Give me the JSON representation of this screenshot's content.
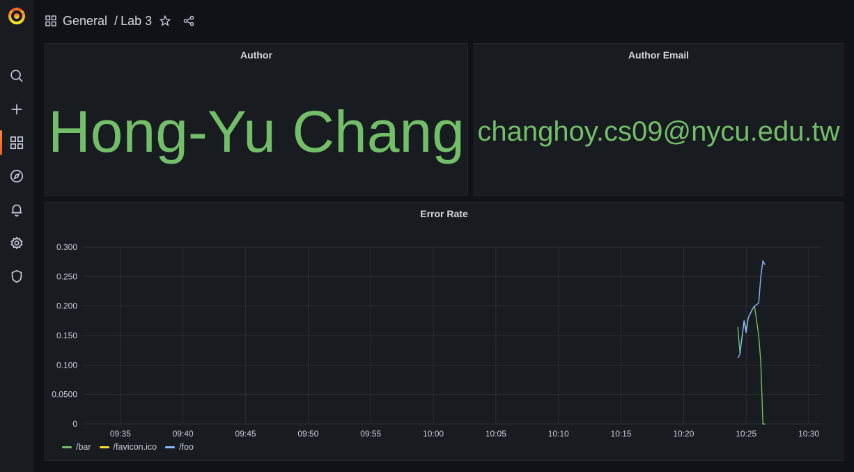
{
  "breadcrumb": {
    "folder": "General",
    "separator": "/",
    "dashboard": "Lab 3"
  },
  "panels": {
    "author": {
      "title": "Author",
      "value": "Hong-Yu Chang"
    },
    "email": {
      "title": "Author Email",
      "value": "changhoy.cs09@nycu.edu.tw"
    },
    "error_rate": {
      "title": "Error Rate"
    }
  },
  "colors": {
    "accent": "#f05a28",
    "stat_green": "#73bf69",
    "series_bar": "#73bf69",
    "series_favicon": "#fade2a",
    "series_foo": "#8ab8ff"
  },
  "chart_data": {
    "type": "line",
    "title": "Error Rate",
    "xlabel": "",
    "ylabel": "",
    "x_ticks": [
      "09:35",
      "09:40",
      "09:45",
      "09:50",
      "09:55",
      "10:00",
      "10:05",
      "10:10",
      "10:15",
      "10:20",
      "10:25",
      "10:30"
    ],
    "y_ticks": [
      "0",
      "0.0500",
      "0.100",
      "0.150",
      "0.200",
      "0.250",
      "0.300"
    ],
    "xlim": [
      "09:32",
      "10:31"
    ],
    "ylim": [
      0,
      0.3
    ],
    "grid": true,
    "legend_position": "bottom-left",
    "series": [
      {
        "name": "/bar",
        "color": "#73bf69",
        "points": [
          [
            "10:24:20",
            0.165
          ],
          [
            "10:24:30",
            0.12
          ],
          [
            "10:24:50",
            0.175
          ],
          [
            "10:25:00",
            0.16
          ],
          [
            "10:25:10",
            0.18
          ],
          [
            "10:25:30",
            0.195
          ],
          [
            "10:25:40",
            0.2
          ],
          [
            "10:26:00",
            0.15
          ],
          [
            "10:26:10",
            0.105
          ],
          [
            "10:26:20",
            0.0
          ],
          [
            "10:26:30",
            0.0
          ]
        ]
      },
      {
        "name": "/favicon.ico",
        "color": "#fade2a",
        "points": []
      },
      {
        "name": "/foo",
        "color": "#8ab8ff",
        "points": [
          [
            "10:24:20",
            0.112
          ],
          [
            "10:24:30",
            0.118
          ],
          [
            "10:24:50",
            0.175
          ],
          [
            "10:25:00",
            0.155
          ],
          [
            "10:25:10",
            0.18
          ],
          [
            "10:25:30",
            0.195
          ],
          [
            "10:25:40",
            0.2
          ],
          [
            "10:26:00",
            0.205
          ],
          [
            "10:26:10",
            0.25
          ],
          [
            "10:26:20",
            0.277
          ],
          [
            "10:26:30",
            0.27
          ]
        ]
      }
    ]
  }
}
